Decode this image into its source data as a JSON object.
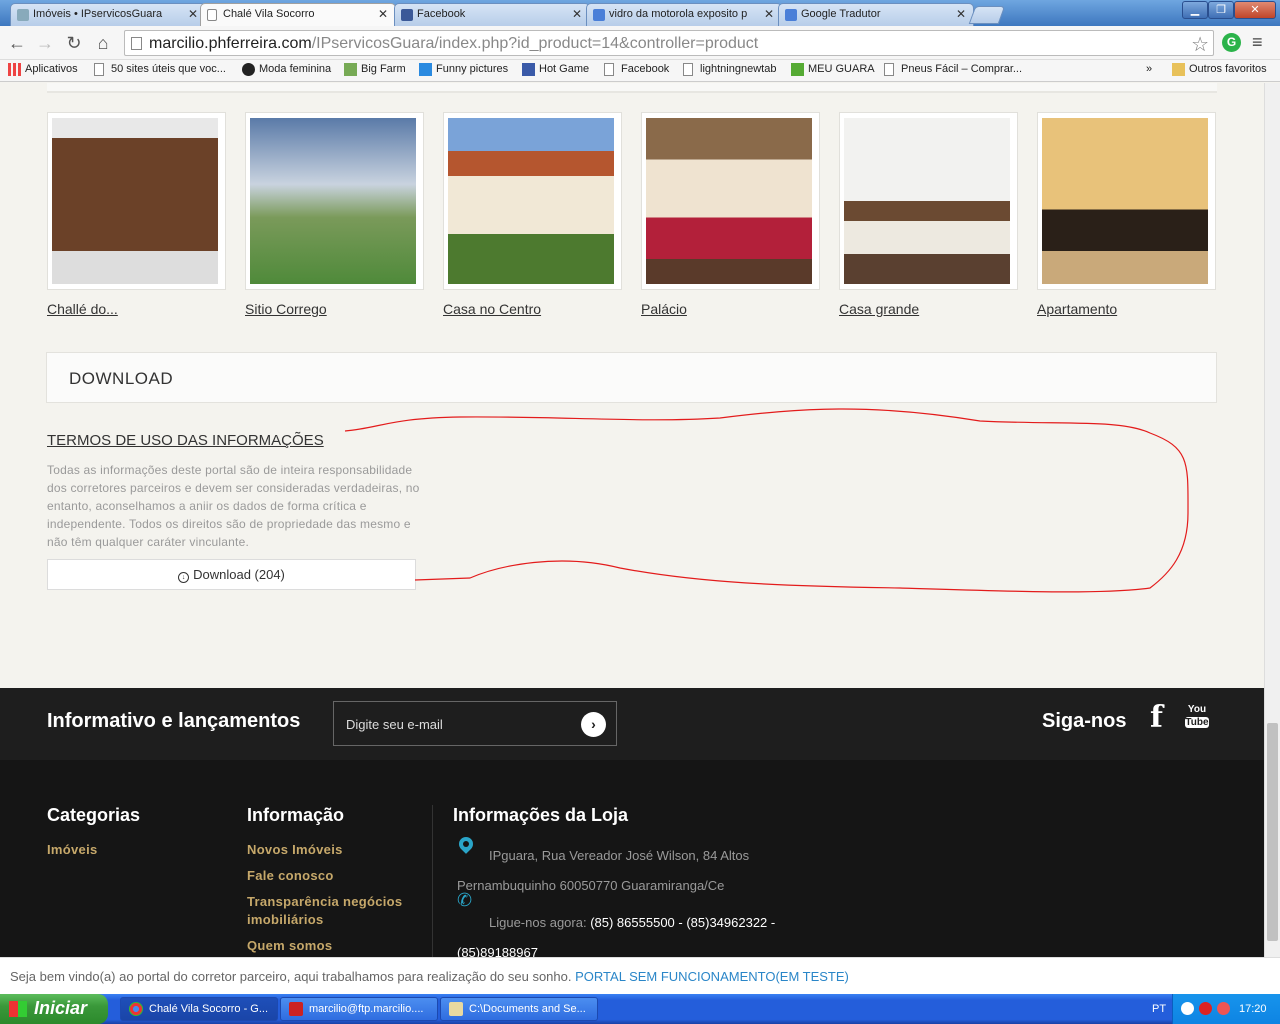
{
  "browser": {
    "tabs": [
      {
        "title": "Imóveis • IPservicosGuara",
        "active": false
      },
      {
        "title": "Chalé Vila Socorro",
        "active": true
      },
      {
        "title": "Facebook",
        "active": false
      },
      {
        "title": "vidro da motorola exposito p",
        "active": false
      },
      {
        "title": "Google Tradutor",
        "active": false
      }
    ],
    "url_host": "marcilio.phferreira.com",
    "url_path": "/IPservicosGuara/index.php?id_product=14&controller=product",
    "bookmarks": [
      "Aplicativos",
      "50 sites úteis que voc...",
      "Moda feminina",
      "Big Farm",
      "Funny pictures",
      "Hot Game",
      "Facebook",
      "lightningnewtab",
      "MEU GUARA",
      "Pneus Fácil – Comprar...",
      "»",
      "Outros favoritos"
    ]
  },
  "products": [
    {
      "label": "Challé do...",
      "icon": "wooden-cabin-image"
    },
    {
      "label": "Sitio Corrego",
      "icon": "field-landscape-image"
    },
    {
      "label": "Casa no Centro",
      "icon": "house-image"
    },
    {
      "label": "Palácio",
      "icon": "palace-hall-image"
    },
    {
      "label": "Casa grande",
      "icon": "bedroom-image"
    },
    {
      "label": "Apartamento",
      "icon": "apartment-image"
    }
  ],
  "download_section": {
    "title": "DOWNLOAD",
    "terms_title": "TERMOS DE USO DAS INFORMAÇÕES",
    "terms_text": "Todas as informações deste portal são de inteira responsabilidade dos corretores parceiros e devem ser consideradas verdadeiras, no entanto, aconselhamos a aniir os dados de forma crítica e independente. Todos os direitos são de propriedade das mesmo e não têm qualquer caráter vinculante.",
    "button_label": "Download (204)"
  },
  "newsletter": {
    "title": "Informativo e lançamentos",
    "placeholder": "Digite seu e-mail",
    "follow_label": "Siga-nos",
    "youtube_top": "You",
    "youtube_bottom": "Tube"
  },
  "footer": {
    "categories_title": "Categorias",
    "categories": [
      "Imóveis"
    ],
    "info_title": "Informação",
    "info_links": [
      "Novos Imóveis",
      "Fale conosco",
      "Transparência negócios imobiliários",
      "Quem somos"
    ],
    "store_title": "Informações da Loja",
    "address_line1": "IPguara, Rua Vereador José Wilson, 84 Altos",
    "address_line2": "Pernambuquinho 60050770 Guaramiranga/Ce",
    "phone_label": "Ligue-nos agora:",
    "phone_numbers": "(85) 86555500 - (85)34962322 -",
    "phone_numbers2": "(85)89188967"
  },
  "notice": {
    "text": "Seja bem vindo(a) ao portal do corretor parceiro, aqui trabalhamos para realização do seu sonho.",
    "link": "PORTAL SEM FUNCIONAMENTO(EM TESTE)"
  },
  "taskbar": {
    "start_label": "Iniciar",
    "windows": [
      "Chalé Vila Socorro - G...",
      "marcilio@ftp.marcilio....",
      "C:\\Documents and Se..."
    ],
    "language": "PT",
    "clock": "17:20"
  }
}
